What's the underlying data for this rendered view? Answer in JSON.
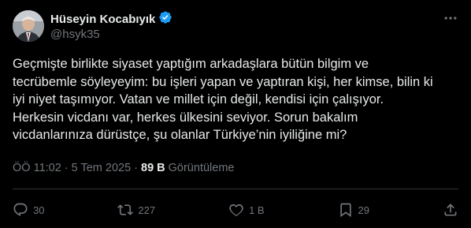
{
  "author": {
    "name": "Hüseyin Kocabıyık",
    "handle": "@hsyk35"
  },
  "tweet": {
    "text": "Geçmişte birlikte siyaset yaptığım arkadaşlara bütün bilgim ve\ntecrübemle söyleyeyim: bu işleri yapan ve yaptıran kişi, her kimse, bilin ki\niyi niyet taşımıyor. Vatan ve millet için değil, kendisi için çalışıyor.\nHerkesin vicdanı var, herkes ülkesini seviyor. Sorun bakalım\nvicdanlarınıza dürüstçe, şu olanlar Türkiye’nin iyiliğine mi?"
  },
  "meta": {
    "time": "ÖÖ 11:02",
    "sep1": "·",
    "date": "5 Tem 2025",
    "sep2": "·",
    "views": "89 B",
    "views_label": "Görüntüleme"
  },
  "actions": {
    "replies": "30",
    "reposts": "227",
    "likes": "1 B",
    "bookmarks": "29"
  },
  "colors": {
    "background": "#000000",
    "text": "#e7e9ea",
    "muted": "#71767b",
    "verified": "#1d9bf0",
    "divider": "#2f3336"
  },
  "icons": [
    "reply-icon",
    "repost-icon",
    "like-icon",
    "bookmark-icon",
    "share-icon",
    "more-icon",
    "verified-badge-icon"
  ]
}
